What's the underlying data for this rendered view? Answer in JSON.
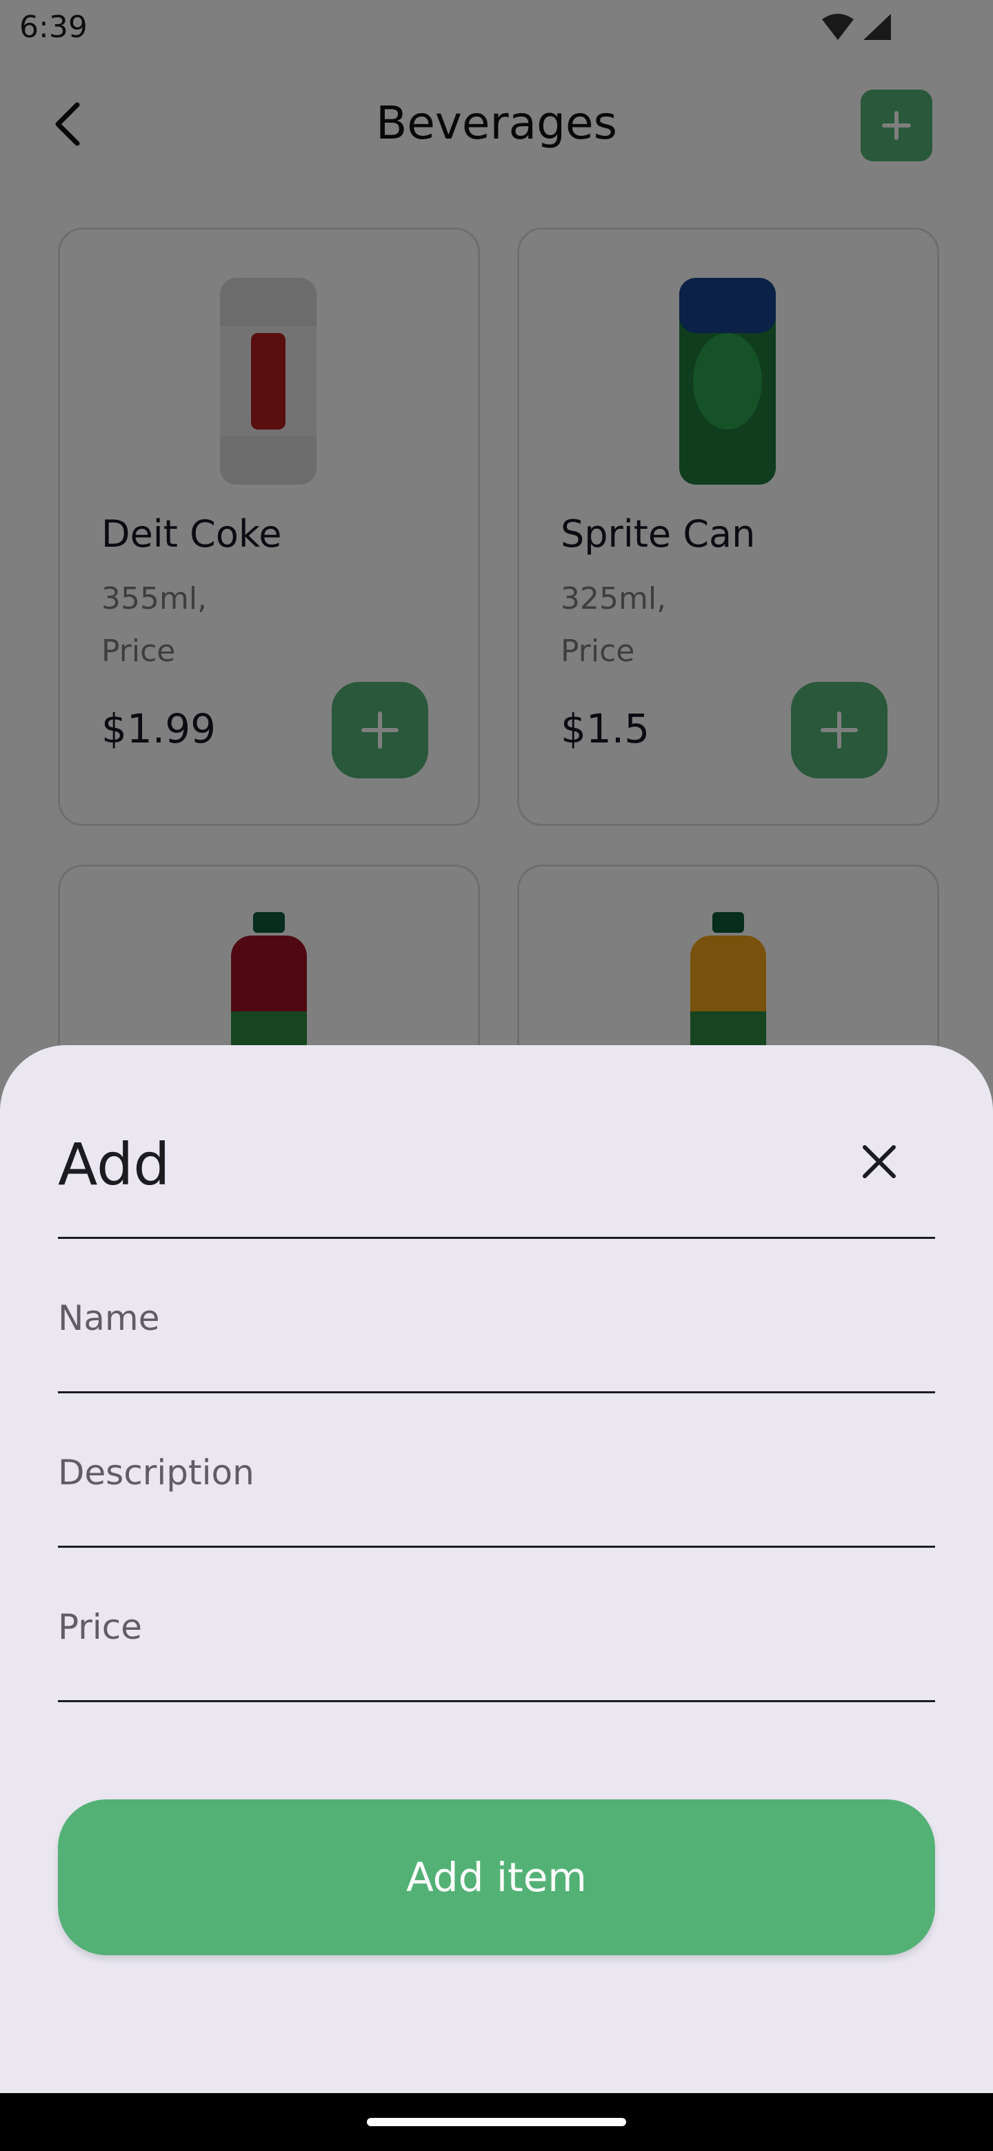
{
  "status_bar": {
    "time": "6:39"
  },
  "header": {
    "title": "Beverages"
  },
  "products": [
    {
      "name": "Deit Coke",
      "size": "355ml,",
      "price_label": "Price",
      "price": "$1.99"
    },
    {
      "name": "Sprite Can",
      "size": "325ml,",
      "price_label": "Price",
      "price": "$1.5"
    },
    {
      "name": "",
      "size": "",
      "price_label": "",
      "price": ""
    },
    {
      "name": "",
      "size": "",
      "price_label": "",
      "price": ""
    }
  ],
  "sheet": {
    "title": "Add",
    "fields": {
      "name_placeholder": "Name",
      "description_placeholder": "Description",
      "price_placeholder": "Price"
    },
    "submit_label": "Add item"
  },
  "colors": {
    "accent": "#53B175",
    "sheet_bg": "#EAE7F1",
    "scrim": "#000000"
  },
  "icons": [
    "back-arrow-icon",
    "plus-icon",
    "close-icon",
    "wifi-icon",
    "signal-icon"
  ]
}
